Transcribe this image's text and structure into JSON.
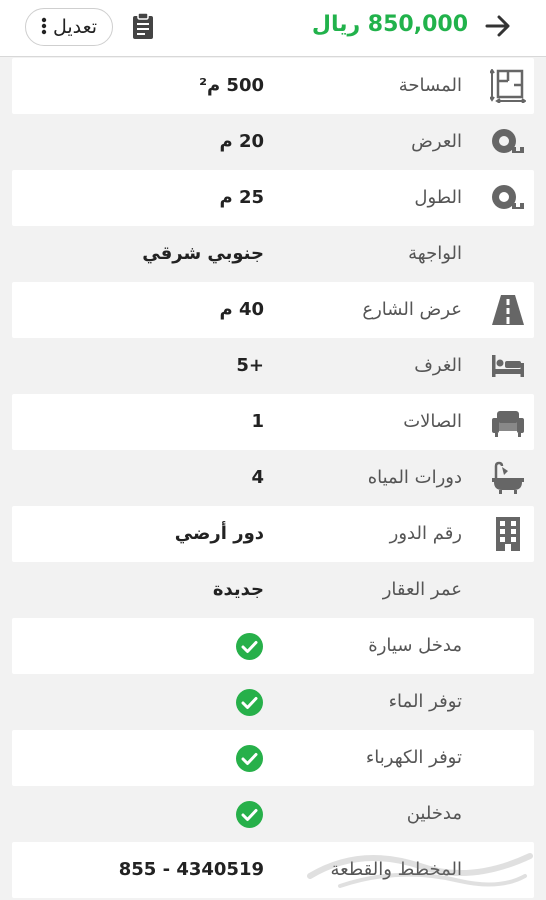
{
  "header": {
    "price": "850,000 ريال",
    "edit_label": "تعديل",
    "back_icon": "arrow-right-icon",
    "clipboard_icon": "clipboard-icon"
  },
  "colors": {
    "accent_green": "#21b24b",
    "check_green": "#27b04a",
    "icon_gray": "#666666"
  },
  "details": [
    {
      "label": "المساحة",
      "value": "500 م²",
      "icon": "area-icon"
    },
    {
      "label": "العرض",
      "value": "20 م",
      "icon": "tape-measure-icon"
    },
    {
      "label": "الطول",
      "value": "25 م",
      "icon": "tape-measure-icon"
    },
    {
      "label": "الواجهة",
      "value": "جنوبي شرقي",
      "icon": ""
    },
    {
      "label": "عرض الشارع",
      "value": "40 م",
      "icon": "road-icon"
    },
    {
      "label": "الغرف",
      "value": "+5",
      "icon": "bed-icon"
    },
    {
      "label": "الصالات",
      "value": "1",
      "icon": "sofa-icon"
    },
    {
      "label": "دورات المياه",
      "value": "4",
      "icon": "bathtub-icon"
    },
    {
      "label": "رقم الدور",
      "value": "دور أرضي",
      "icon": "building-icon"
    },
    {
      "label": "عمر العقار",
      "value": "جديدة",
      "icon": ""
    },
    {
      "label": "مدخل سيارة",
      "value": "",
      "icon": "",
      "checked": true
    },
    {
      "label": "توفر الماء",
      "value": "",
      "icon": "",
      "checked": true
    },
    {
      "label": "توفر الكهرباء",
      "value": "",
      "icon": "",
      "checked": true
    },
    {
      "label": "مدخلين",
      "value": "",
      "icon": "",
      "checked": true
    },
    {
      "label": "المخطط والقطعة",
      "value": "855 - 4340519",
      "icon": ""
    }
  ]
}
